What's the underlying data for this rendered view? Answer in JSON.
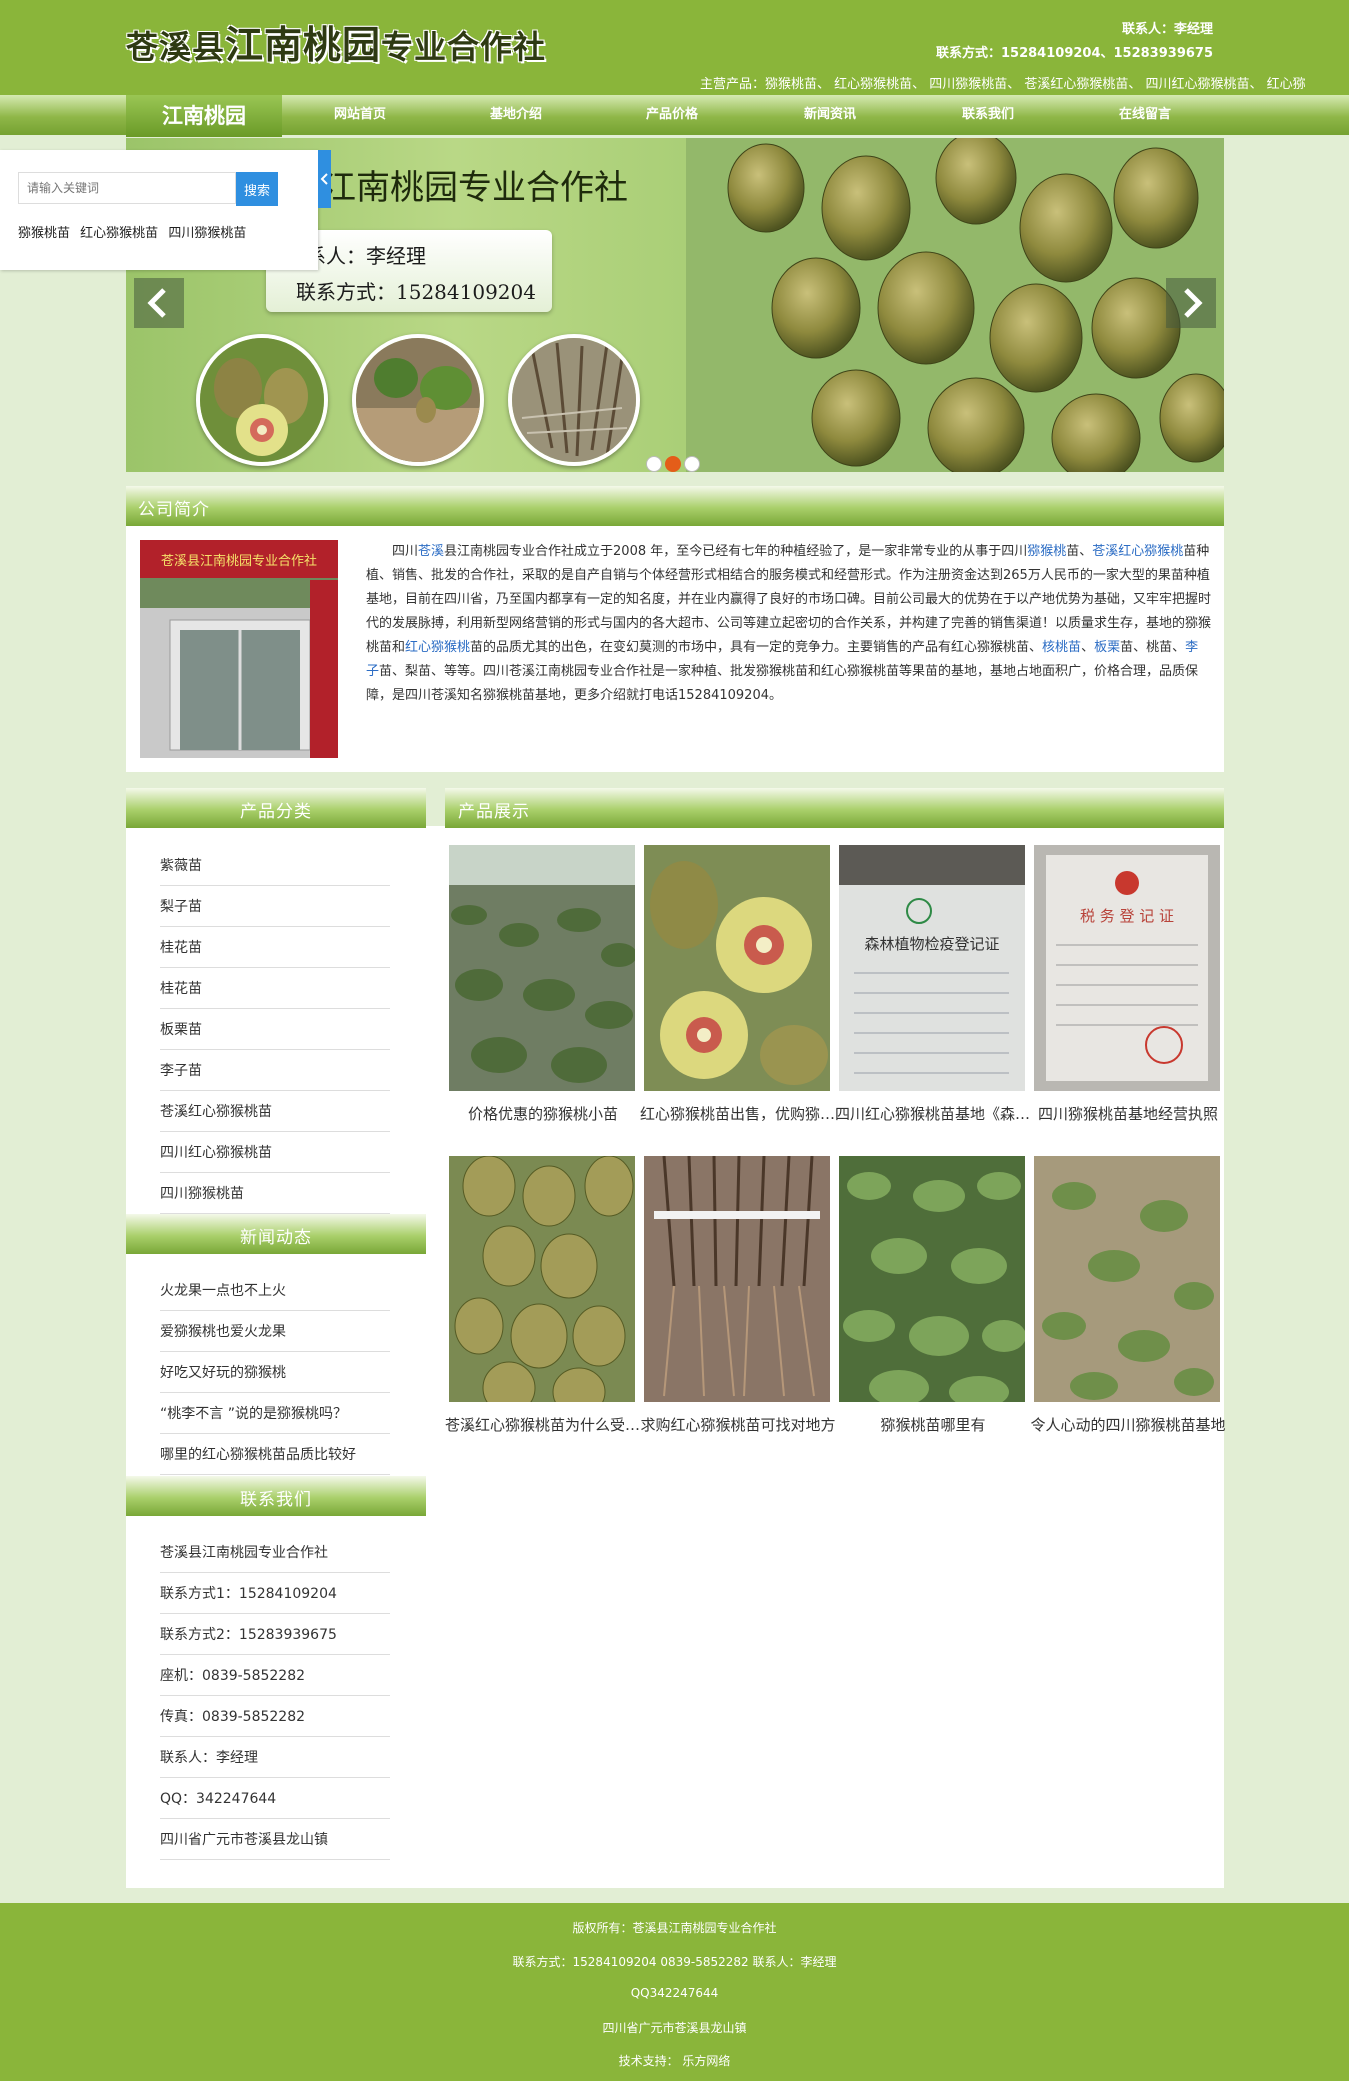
{
  "header": {
    "site_name_part1": "苍溪县",
    "site_name_part2": "江南桃园",
    "site_name_part3": "专业合作社",
    "contact_person": "联系人：李经理",
    "contact_phone": "联系方式：15284109204、15283939675",
    "main_products": "主营产品：猕猴桃苗、 红心猕猴桃苗、 四川猕猴桃苗、 苍溪红心猕猴桃苗、 四川红心猕猴桃苗、 红心猕"
  },
  "nav": {
    "brand": "江南桃园",
    "items": [
      "网站首页",
      "基地介绍",
      "产品价格",
      "新闻资讯",
      "联系我们",
      "在线留言"
    ]
  },
  "search": {
    "placeholder": "请输入关键词",
    "button": "搜索",
    "hot_words": [
      "猕猴桃苗",
      "红心猕猴桃苗",
      "四川猕猴桃苗"
    ]
  },
  "banner": {
    "title": "江南桃园专业合作社",
    "contact_person": "联系人：李经理",
    "contact_phone": "联系方式：15284109204"
  },
  "about": {
    "title": "公司简介",
    "p1": "四川",
    "l1": "苍溪",
    "p2": "县江南桃园专业合作社成立于2008 年，至今已经有七年的种植经验了，是一家非常专业的从事于四川",
    "l2": "猕猴桃",
    "p3": "苗、",
    "l3": "苍溪红心猕猴桃",
    "p4": "苗种植、销售、批发的合作社，采取的是自产自销与个体经营形式相结合的服务模式和经营形式。作为注册资金达到265万人民币的一家大型的果苗种植基地，目前在四川省，乃至国内都享有一定的知名度，并在业内赢得了良好的市场口碑。目前公司最大的优势在于以产地优势为基础，又牢牢把握时代的发展脉搏，利用新型网络营销的形式与国内的各大超市、公司等建立起密切的合作关系，并构建了完善的销售渠道！以质量求生存，基地的猕猴桃苗和",
    "l4": "红心猕猴桃",
    "p5": "苗的品质尤其的出色，在变幻莫测的市场中，具有一定的竞争力。主要销售的产品有红心猕猴桃苗、",
    "l5": "核桃苗",
    "p6": "、",
    "l6": "板栗",
    "p7": "苗、桃苗、",
    "l7": "李子",
    "p8": "苗、梨苗、等等。四川苍溪江南桃园专业合作社是一家种植、批发猕猴桃苗和红心猕猴桃苗等果苗的基地，基地占地面积广，价格合理，品质保障，是四川苍溪知名猕猴桃苗基地，更多介绍就打电话15284109204。"
  },
  "categories": {
    "title": "产品分类",
    "items": [
      "紫薇苗",
      "梨子苗",
      "桂花苗",
      "桂花苗",
      "板栗苗",
      "李子苗",
      "苍溪红心猕猴桃苗",
      "四川红心猕猴桃苗",
      "四川猕猴桃苗"
    ]
  },
  "news": {
    "title": "新闻动态",
    "items": [
      "火龙果一点也不上火",
      "爱猕猴桃也爱火龙果",
      "好吃又好玩的猕猴桃",
      "“桃李不言 ”说的是猕猴桃吗？",
      "哪里的红心猕猴桃苗品质比较好"
    ]
  },
  "contact": {
    "title": "联系我们",
    "items": [
      "苍溪县江南桃园专业合作社",
      "联系方式1：15284109204",
      "联系方式2：15283939675",
      "座机：0839-5852282",
      "传真：0839-5852282",
      "联系人：李经理",
      "QQ：342247644",
      "四川省广元市苍溪县龙山镇"
    ]
  },
  "products": {
    "title": "产品展示",
    "items": [
      "价格优惠的猕猴桃小苗",
      "红心猕猴桃苗出售，优购猕猴桃苗",
      "四川红心猕猴桃苗基地《森林植物检疫登记证》",
      "四川猕猴桃苗基地经营执照",
      "苍溪红心猕猴桃苗为什么受欢迎",
      "求购红心猕猴桃苗可找对地方",
      "猕猴桃苗哪里有",
      "令人心动的四川猕猴桃苗基地"
    ],
    "cert_text_1": "森林植物检疫登记证",
    "cert_text_2": "税 务 登 记 证"
  },
  "footer": {
    "copyright": "版权所有：苍溪县江南桃园专业合作社",
    "contact": "联系方式：15284109204   0839-5852282   联系人：李经理",
    "qq": "QQ342247644",
    "address": "四川省广元市苍溪县龙山镇",
    "support": "技术支持：  乐方网络"
  },
  "colors": {
    "header_green": "#8ab53a",
    "page_bg": "#e2eed4",
    "search_blue": "#2f8fe0",
    "link_blue": "#2b6cc4",
    "active_dot": "#e45d19"
  }
}
